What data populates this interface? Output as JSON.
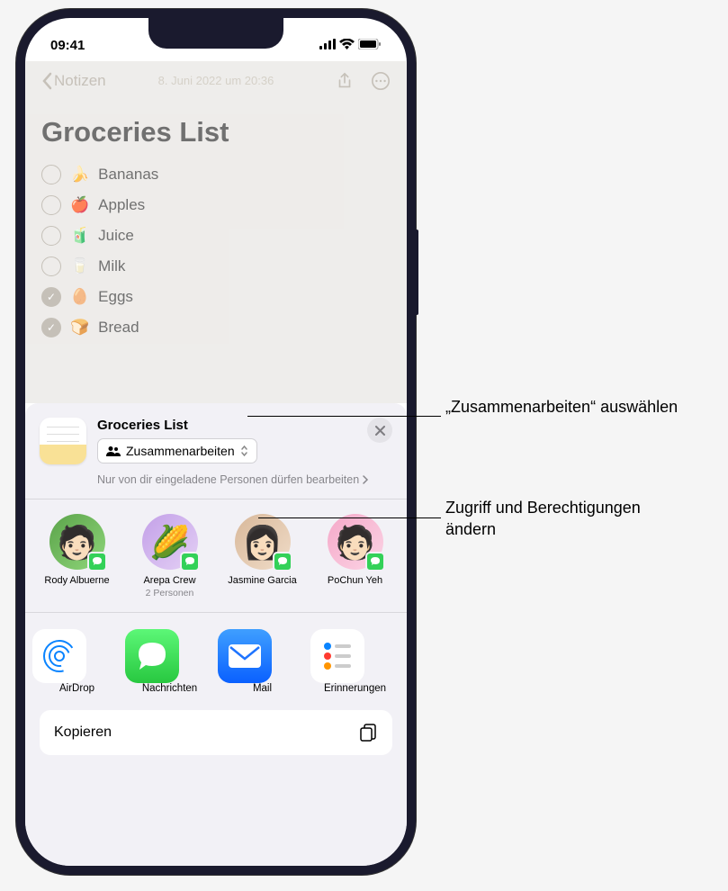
{
  "status": {
    "time": "09:41"
  },
  "nav": {
    "back": "Notizen"
  },
  "note": {
    "date": "8. Juni 2022 um 20:36",
    "title": "Groceries List",
    "items": [
      {
        "emoji": "🍌",
        "text": "Bananas",
        "checked": false
      },
      {
        "emoji": "🍎",
        "text": "Apples",
        "checked": false
      },
      {
        "emoji": "🧃",
        "text": "Juice",
        "checked": false
      },
      {
        "emoji": "🥛",
        "text": "Milk",
        "checked": false
      },
      {
        "emoji": "🥚",
        "text": "Eggs",
        "checked": true
      },
      {
        "emoji": "🍞",
        "text": "Bread",
        "checked": true
      }
    ]
  },
  "sheet": {
    "title": "Groceries List",
    "collab_label": "Zusammenarbeiten",
    "permissions": "Nur von dir eingeladene Personen dürfen bearbeiten",
    "contacts": [
      {
        "name": "Rody Albuerne",
        "sub": ""
      },
      {
        "name": "Arepa Crew",
        "sub": "2 Personen"
      },
      {
        "name": "Jasmine Garcia",
        "sub": ""
      },
      {
        "name": "PoChun Yeh",
        "sub": ""
      }
    ],
    "apps": [
      {
        "name": "AirDrop"
      },
      {
        "name": "Nachrichten"
      },
      {
        "name": "Mail"
      },
      {
        "name": "Erinnerungen"
      }
    ],
    "copy": "Kopieren"
  },
  "callouts": {
    "c1": "„Zusammenarbeiten“ auswählen",
    "c2": "Zugriff und Berechtigungen ändern"
  }
}
